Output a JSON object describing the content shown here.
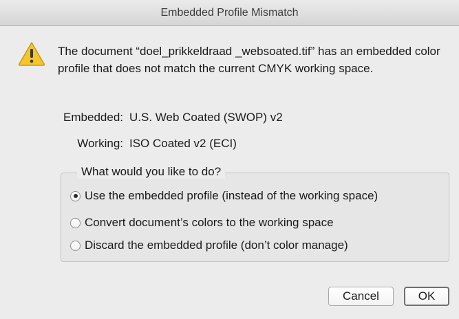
{
  "window": {
    "title": "Embedded Profile Mismatch"
  },
  "message": "The document “doel_prikkeldraad _websoated.tif” has an embedded color profile that does not match the current CMYK working space.",
  "profiles": {
    "embedded_label": "Embedded:",
    "embedded_value": "U.S. Web Coated (SWOP) v2",
    "working_label": "Working:",
    "working_value": "ISO Coated v2 (ECI)"
  },
  "options_group": {
    "title": "What would you like to do?",
    "options": [
      {
        "label": "Use the embedded profile (instead of the working space)",
        "selected": true
      },
      {
        "label": "Convert document’s colors to the working space",
        "selected": false
      },
      {
        "label": "Discard the embedded profile (don’t color manage)",
        "selected": false
      }
    ]
  },
  "buttons": {
    "cancel": "Cancel",
    "ok": "OK"
  },
  "icons": {
    "warning": "warning-icon"
  },
  "colors": {
    "warning_fill": "#f7c52b",
    "warning_border": "#c79a12"
  }
}
